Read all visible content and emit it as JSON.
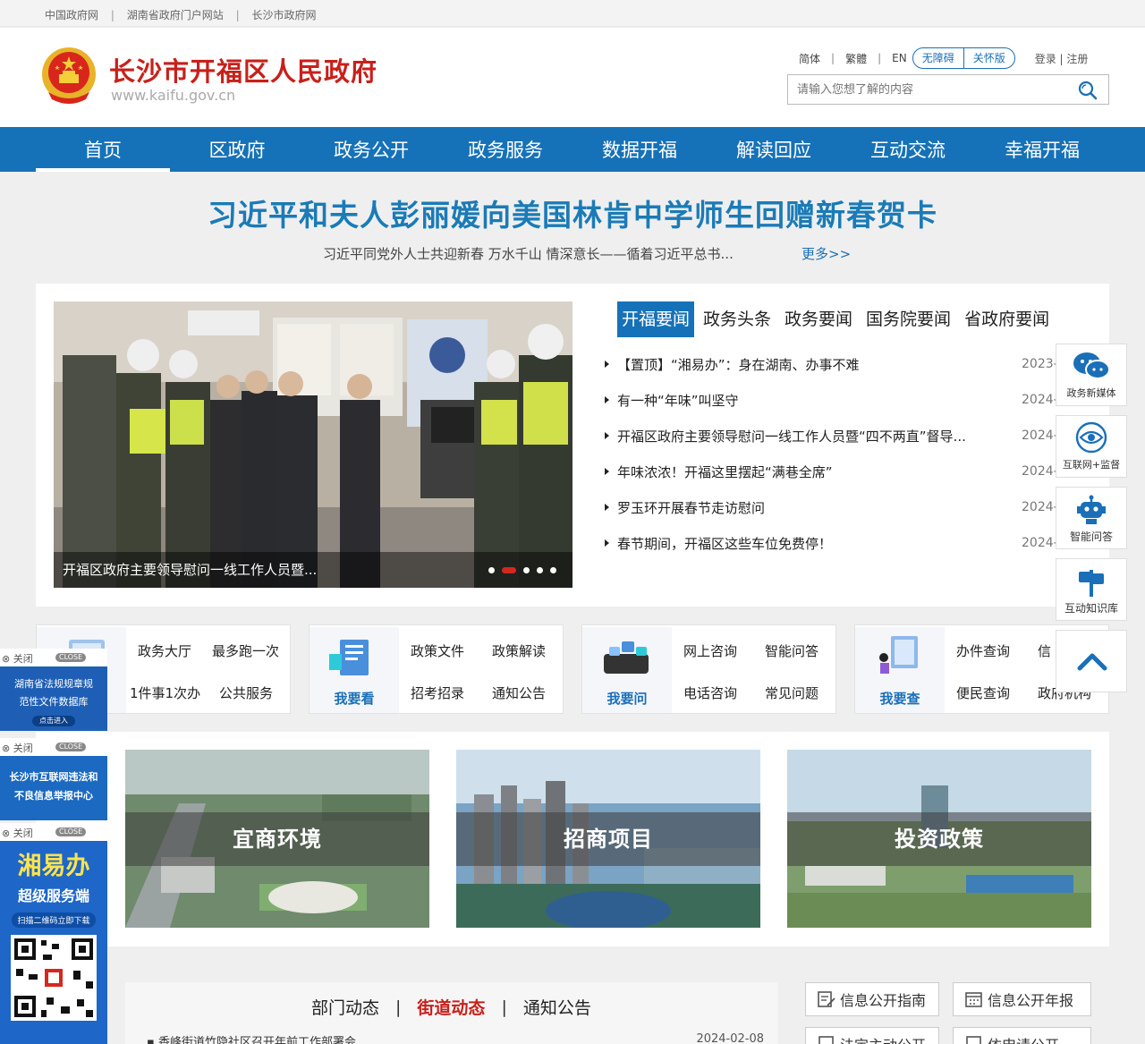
{
  "topbar": {
    "links": [
      "中国政府网",
      "湖南省政府门户网站",
      "长沙市政府网"
    ],
    "separator": "|"
  },
  "header": {
    "title": "长沙市开福区人民政府",
    "url": "www.kaifu.gov.cn",
    "lang_simplified": "简体",
    "lang_traditional": "繁體",
    "lang_en": "EN",
    "accessibility": "无障碍",
    "elder_mode": "关怀版",
    "login": "登录 | 注册",
    "search_placeholder": "请输入您想了解的内容"
  },
  "nav": {
    "items": [
      "首页",
      "区政府",
      "政务公开",
      "政务服务",
      "数据开福",
      "解读回应",
      "互动交流",
      "幸福开福"
    ],
    "active": "首页"
  },
  "headline": {
    "title": "习近平和夫人彭丽媛向美国林肯中学师生回赠新春贺卡",
    "sub": "习近平同党外人士共迎新春  万水千山  情深意长——循着习近平总书...",
    "more": "更多>>"
  },
  "slider": {
    "caption": "开福区政府主要领导慰问一线工作人员暨..."
  },
  "news": {
    "tabs": [
      "开福要闻",
      "政务头条",
      "政务要闻",
      "国务院要闻",
      "省政府要闻"
    ],
    "items": [
      {
        "title": "【置顶】“湘易办”：身在湖南、办事不难",
        "date": "2023-"
      },
      {
        "title": "有一种“年味”叫坚守",
        "date": "2024-"
      },
      {
        "title": "开福区政府主要领导慰问一线工作人员暨“四不两直”督导...",
        "date": "2024-"
      },
      {
        "title": "年味浓浓！开福这里摆起“满巷全席”",
        "date": "2024-"
      },
      {
        "title": "罗玉环开展春节走访慰问",
        "date": "2024-"
      },
      {
        "title": "春节期间，开福区这些车位免费停！",
        "date": "2024-"
      }
    ]
  },
  "services": [
    {
      "label": "",
      "links": [
        "政务大厅",
        "最多跑一次",
        "1件事1次办",
        "公共服务"
      ]
    },
    {
      "label": "我要看",
      "links": [
        "政策文件",
        "政策解读",
        "招考招录",
        "通知公告"
      ]
    },
    {
      "label": "我要问",
      "links": [
        "网上咨询",
        "智能问答",
        "电话咨询",
        "常见问题"
      ]
    },
    {
      "label": "我要查",
      "links": [
        "办件查询",
        "信",
        "便民查询",
        "政府机构"
      ]
    }
  ],
  "features": [
    "宜商环境",
    "招商项目",
    "投资政策"
  ],
  "bottom": {
    "tabs": [
      "部门动态",
      "街道动态",
      "通知公告"
    ],
    "active_tab": "街道动态",
    "first_item": "香峰街道竹隐社区召开年前工作部署会",
    "first_date": "2024-02-08",
    "buttons": [
      "信息公开指南",
      "信息公开年报",
      "法定主动公开",
      "依申请公开"
    ]
  },
  "left_float": {
    "close": "关闭",
    "close_en": "CLOSE",
    "ad1": "湖南省法规规章规范性文件数据库",
    "ad1_btn": "点击进入",
    "ad2": "长沙市互联网违法和不良信息举报中心",
    "ad3_title": "湘易办",
    "ad3_sub": "超级服务端",
    "ad3_btn": "扫描二维码立即下载"
  },
  "right_float": [
    "政务新媒体",
    "互联网+监督",
    "智能问答",
    "互动知识库"
  ],
  "colors": {
    "primary": "#1672b8",
    "red": "#c8201a",
    "headline": "#1a7bb7"
  }
}
